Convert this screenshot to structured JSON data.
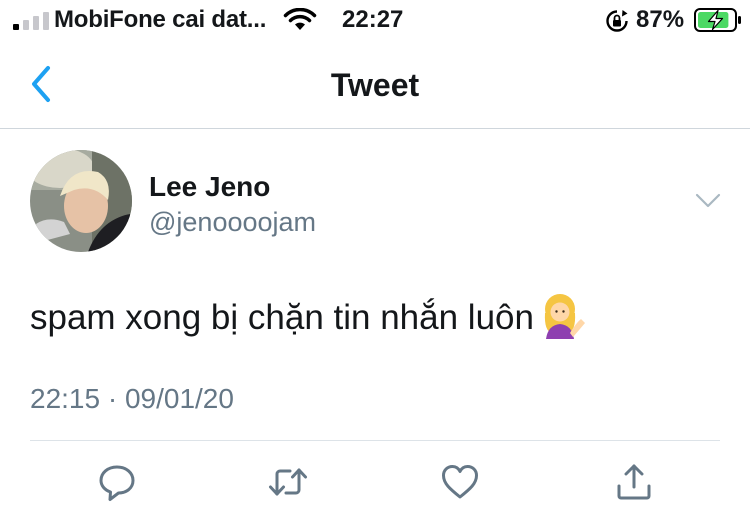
{
  "status_bar": {
    "carrier": "MobiFone cai dat...",
    "time": "22:27",
    "battery_percent": "87%",
    "battery_level": 0.87,
    "signal_bars_active": 1,
    "signal_bars_total": 4
  },
  "nav": {
    "title": "Tweet"
  },
  "tweet": {
    "author_name": "Lee Jeno",
    "author_handle": "@jenoooojam",
    "text": "spam xong bị chặn tin nhắn luôn",
    "emoji": "person-tipping-hand-emoji",
    "timestamp": "22:15 · 09/01/20"
  },
  "actions": [
    "reply-icon",
    "retweet-icon",
    "like-icon",
    "share-icon"
  ],
  "colors": {
    "accent": "#1da1f2",
    "secondary_text": "#657786",
    "icon_gray": "#657786",
    "battery_green": "#4cd964"
  }
}
